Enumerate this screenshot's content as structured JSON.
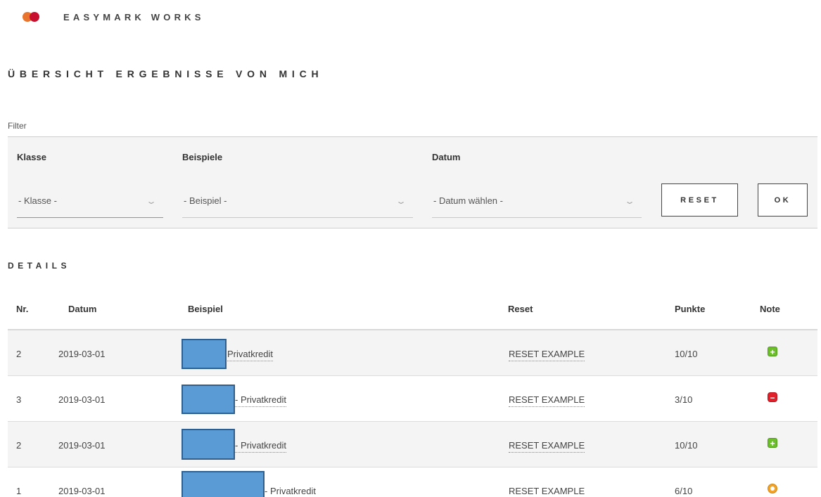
{
  "brand": {
    "name": "EASYMARK WORKS"
  },
  "page_title": "ÜBERSICHT ERGEBNISSE VON MICH",
  "filter": {
    "label": "Filter",
    "klasse": {
      "label": "Klasse",
      "value": "- Klasse -"
    },
    "beispiele": {
      "label": "Beispiele",
      "value": "- Beispiel -"
    },
    "datum": {
      "label": "Datum",
      "value": "- Datum wählen -"
    },
    "reset_label": "RESET",
    "ok_label": "OK"
  },
  "details": {
    "title": "DETAILS",
    "columns": [
      "Nr.",
      "Datum",
      "Beispiel",
      "Reset",
      "Punkte",
      "Note"
    ],
    "rows": [
      {
        "nr": "2",
        "datum": "2019-03-01",
        "beispiel": "Privatkredit",
        "reset": "RESET EXAMPLE",
        "punkte": "10/10",
        "note": "plus"
      },
      {
        "nr": "3",
        "datum": "2019-03-01",
        "beispiel": "- Privatkredit",
        "reset": "RESET EXAMPLE",
        "punkte": "3/10",
        "note": "minus"
      },
      {
        "nr": "2",
        "datum": "2019-03-01",
        "beispiel": "- Privatkredit",
        "reset": "RESET EXAMPLE",
        "punkte": "10/10",
        "note": "plus"
      },
      {
        "nr": "1",
        "datum": "2019-03-01",
        "beispiel": "- Privatkredit",
        "reset": "RESET EXAMPLE",
        "punkte": "6/10",
        "note": "mid"
      }
    ]
  },
  "icons": {
    "chevron": "chevron-down-icon",
    "grade_plus": "plus-square-icon",
    "grade_minus": "minus-square-icon",
    "grade_mid": "circle-dot-icon"
  },
  "colors": {
    "brand_orange": "#e8742e",
    "brand_red": "#c8102e",
    "redaction": "#5b9bd5",
    "grade_good": "#6cbf2a",
    "grade_bad": "#e0202a",
    "grade_mid": "#f3a428"
  }
}
